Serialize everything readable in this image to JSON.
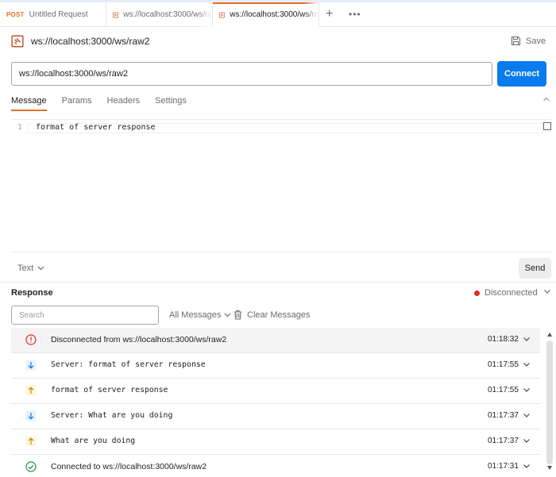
{
  "tabs": [
    {
      "method": "POST",
      "label": "Untitled Request",
      "active": false
    },
    {
      "label": "ws://localhost:3000/ws/ra",
      "active": false
    },
    {
      "label": "ws://localhost:3000/ws/ra",
      "active": true
    }
  ],
  "tabbar": {
    "add": "+",
    "more": "•••"
  },
  "header": {
    "title": "ws://localhost:3000/ws/raw2",
    "save_label": "Save"
  },
  "url": {
    "value": "ws://localhost:3000/ws/raw2",
    "connect_label": "Connect"
  },
  "subtabs": [
    "Message",
    "Params",
    "Headers",
    "Settings"
  ],
  "editor": {
    "line_number": "1",
    "code": "format of server response"
  },
  "composer": {
    "format": "Text",
    "send_label": "Send"
  },
  "response": {
    "label": "Response",
    "status": "Disconnected",
    "search_placeholder": "Search",
    "filter": "All Messages",
    "clear": "Clear Messages",
    "messages": [
      {
        "kind": "error",
        "text": "Disconnected from ws://localhost:3000/ws/raw2",
        "time": "01:18:32"
      },
      {
        "kind": "incoming",
        "text": "Server: format of server response",
        "time": "01:17:55"
      },
      {
        "kind": "outgoing",
        "text": "format of server response",
        "time": "01:17:55"
      },
      {
        "kind": "incoming",
        "text": "Server: What are you doing",
        "time": "01:17:37"
      },
      {
        "kind": "outgoing",
        "text": "What are you doing",
        "time": "01:17:37"
      },
      {
        "kind": "connected",
        "text": "Connected to ws://localhost:3000/ws/raw2",
        "time": "01:17:31"
      }
    ]
  },
  "colors": {
    "accent": "#e2702a",
    "primary": "#097bed",
    "error": "#e02b20",
    "success": "#1d8c3c"
  }
}
